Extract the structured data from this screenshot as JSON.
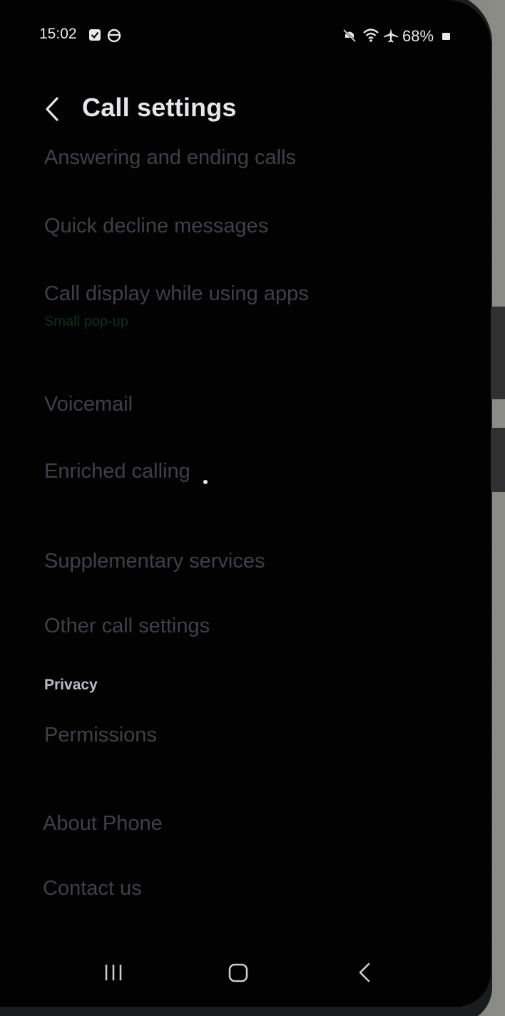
{
  "status_bar": {
    "time": "15:02",
    "icons_left": [
      "checkbox-notification-icon",
      "alarm-clock-icon"
    ],
    "icons_right": [
      "mute-icon",
      "wifi-icon",
      "airplane-icon"
    ],
    "battery_percent": "68%"
  },
  "header": {
    "title": "Call settings",
    "back_icon": "chevron-left-icon"
  },
  "items": [
    {
      "label": "Answering and ending calls"
    },
    {
      "label": "Quick decline messages"
    },
    {
      "label": "Call display while using apps",
      "sublabel": "Small pop-up"
    },
    {
      "label": "Voicemail"
    },
    {
      "label": "Enriched calling"
    },
    {
      "label": "Supplementary services"
    },
    {
      "label": "Other call settings"
    }
  ],
  "privacy": {
    "section_title": "Privacy",
    "items": [
      {
        "label": "Permissions"
      }
    ]
  },
  "footer_items": [
    {
      "label": "About Phone"
    },
    {
      "label": "Contact us"
    }
  ],
  "nav_bar": {
    "recents_icon": "recents-icon",
    "home_icon": "home-icon",
    "back_icon": "back-icon"
  },
  "colors": {
    "screen_bg": "#020203",
    "dimmed_text": "#3f4048",
    "title_text": "#e6e6ea",
    "section_text": "#b9bac8"
  }
}
